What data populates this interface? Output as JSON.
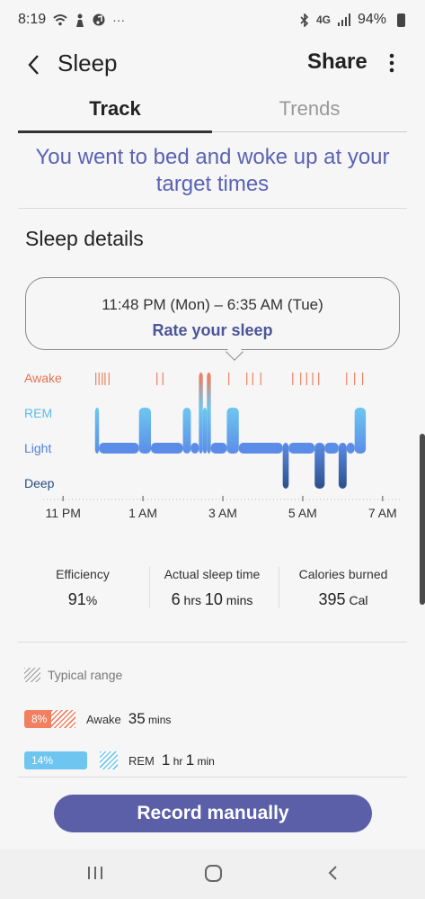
{
  "status_bar": {
    "time": "8:19",
    "left_icons": [
      "wifi-icon",
      "person-icon",
      "media-icon"
    ],
    "overflow": "···",
    "right_icons": [
      "bluetooth-icon",
      "lte-icon",
      "signal-icon"
    ],
    "network": "4G",
    "battery": "94%"
  },
  "app_bar": {
    "title": "Sleep",
    "share_label": "Share"
  },
  "tabs": [
    {
      "label": "Track",
      "selected": true
    },
    {
      "label": "Trends",
      "selected": false
    }
  ],
  "headline": "You went to bed and woke up at your target times",
  "sleep_details": {
    "title": "Sleep details",
    "time_range": "11:48 PM (Mon) – 6:35 AM (Tue)",
    "rate_label": "Rate your sleep"
  },
  "chart_data": {
    "type": "area",
    "stages": [
      {
        "name": "Awake",
        "color": "#f08060"
      },
      {
        "name": "REM",
        "color": "#6ec6f0"
      },
      {
        "name": "Light",
        "color": "#5b8de8"
      },
      {
        "name": "Deep",
        "color": "#2d4f8a"
      }
    ],
    "x_tick_labels": [
      "11 PM",
      "1 AM",
      "3 AM",
      "5 AM",
      "7 AM"
    ],
    "x_hours": [
      23,
      25,
      27,
      29,
      31
    ],
    "xlim": [
      22.5,
      31.5
    ],
    "segments": [
      {
        "stage": "REM",
        "start": 23.8,
        "end": 23.9
      },
      {
        "stage": "Light",
        "start": 23.9,
        "end": 24.9
      },
      {
        "stage": "REM",
        "start": 24.9,
        "end": 25.2
      },
      {
        "stage": "Light",
        "start": 25.2,
        "end": 26.0
      },
      {
        "stage": "REM",
        "start": 26.0,
        "end": 26.2
      },
      {
        "stage": "Light",
        "start": 26.2,
        "end": 26.4
      },
      {
        "stage": "Awake",
        "start": 26.4,
        "end": 26.5
      },
      {
        "stage": "REM",
        "start": 26.5,
        "end": 26.6
      },
      {
        "stage": "Awake",
        "start": 26.6,
        "end": 26.7
      },
      {
        "stage": "Light",
        "start": 26.7,
        "end": 27.1
      },
      {
        "stage": "REM",
        "start": 27.1,
        "end": 27.4
      },
      {
        "stage": "Light",
        "start": 27.4,
        "end": 28.5
      },
      {
        "stage": "Deep",
        "start": 28.5,
        "end": 28.65
      },
      {
        "stage": "Light",
        "start": 28.65,
        "end": 29.3
      },
      {
        "stage": "Deep",
        "start": 29.3,
        "end": 29.55
      },
      {
        "stage": "Light",
        "start": 29.55,
        "end": 29.9
      },
      {
        "stage": "Deep",
        "start": 29.9,
        "end": 30.1
      },
      {
        "stage": "Light",
        "start": 30.1,
        "end": 30.3
      },
      {
        "stage": "REM",
        "start": 30.3,
        "end": 30.58
      }
    ],
    "awake_ticks": [
      23.82,
      23.9,
      23.98,
      24.05,
      24.15,
      25.35,
      25.5,
      26.45,
      26.65,
      27.15,
      27.6,
      27.75,
      27.95,
      28.75,
      28.95,
      29.1,
      29.25,
      29.4,
      30.1,
      30.3,
      30.5
    ]
  },
  "stats": [
    {
      "label": "Efficiency",
      "value": "91",
      "unit": "%"
    },
    {
      "label": "Actual sleep time",
      "value_parts": [
        "6",
        " hrs ",
        "10",
        " mins"
      ]
    },
    {
      "label": "Calories burned",
      "value": "395",
      "unit": " Cal"
    }
  ],
  "legend": {
    "typical_label": "Typical range",
    "rows": [
      {
        "pct": "8%",
        "pct_value": 8,
        "stage": "Awake",
        "dur": "35",
        "dur_unit": " mins",
        "color": "#f08060"
      },
      {
        "pct": "14%",
        "pct_value": 14,
        "stage": "REM",
        "dur_parts": [
          "1",
          " hr ",
          "1",
          " min"
        ],
        "color": "#6ec6f0"
      }
    ]
  },
  "record_label": "Record manually"
}
